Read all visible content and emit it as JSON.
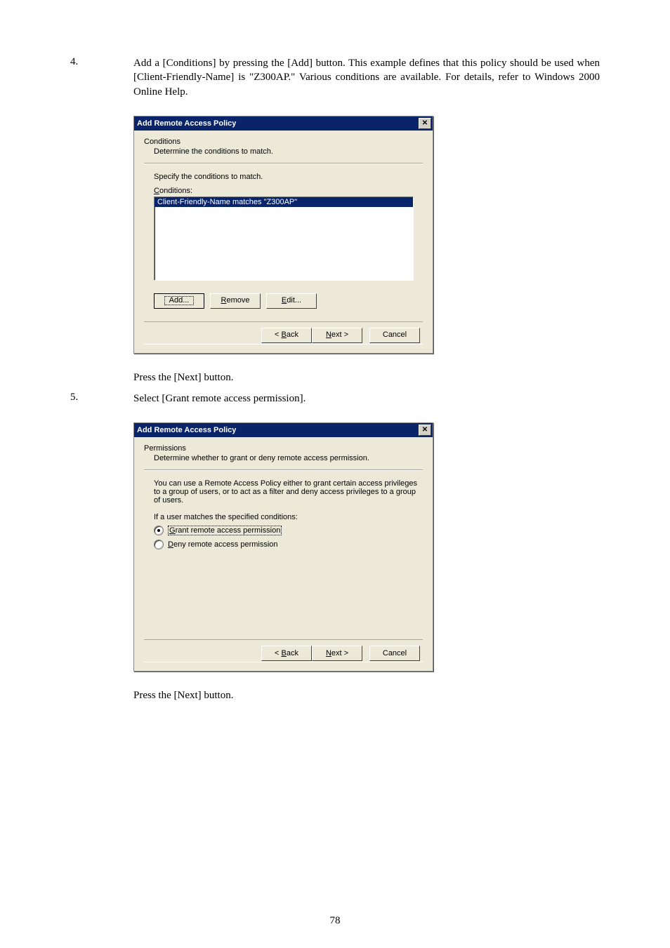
{
  "steps": {
    "four": {
      "num": "4.",
      "text": "Add a [Conditions] by pressing the [Add] button.   This example defines that this policy should be used when [Client-Friendly-Name] is \"Z300AP.\"  Various conditions are available.  For details, refer to Windows 2000 Online Help."
    },
    "press_next_1": "Press the [Next] button.",
    "five": {
      "num": "5.",
      "text": "Select [Grant remote access permission]."
    },
    "press_next_2": "Press the [Next] button."
  },
  "dialog1": {
    "title": "Add Remote Access Policy",
    "heading": "Conditions",
    "subheading": "Determine the conditions to match.",
    "specify": "Specify the conditions to match.",
    "conditions_label_pre": "C",
    "conditions_label_post": "onditions:",
    "list_item": "Client-Friendly-Name matches \"Z300AP\"",
    "btn_add": "Add...",
    "btn_remove_pre": "R",
    "btn_remove_post": "emove",
    "btn_edit_pre": "E",
    "btn_edit_post": "dit...",
    "btn_back_pre": "< ",
    "btn_back_u": "B",
    "btn_back_post": "ack",
    "btn_next_u": "N",
    "btn_next_post": "ext >",
    "btn_cancel": "Cancel"
  },
  "dialog2": {
    "title": "Add Remote Access Policy",
    "heading": "Permissions",
    "subheading": "Determine whether to grant or deny remote access permission.",
    "explain": "You can use a Remote Access Policy either to grant certain access privileges to a group of users, or to act as a filter and deny access privileges to a group of users.",
    "ifmatch": "If a user matches the specified conditions:",
    "radio_grant_u": "G",
    "radio_grant_post": "rant remote access permission",
    "radio_deny_u": "D",
    "radio_deny_post": "eny remote access permission",
    "btn_back_pre": "< ",
    "btn_back_u": "B",
    "btn_back_post": "ack",
    "btn_next_u": "N",
    "btn_next_post": "ext >",
    "btn_cancel": "Cancel"
  },
  "page_number": "78"
}
